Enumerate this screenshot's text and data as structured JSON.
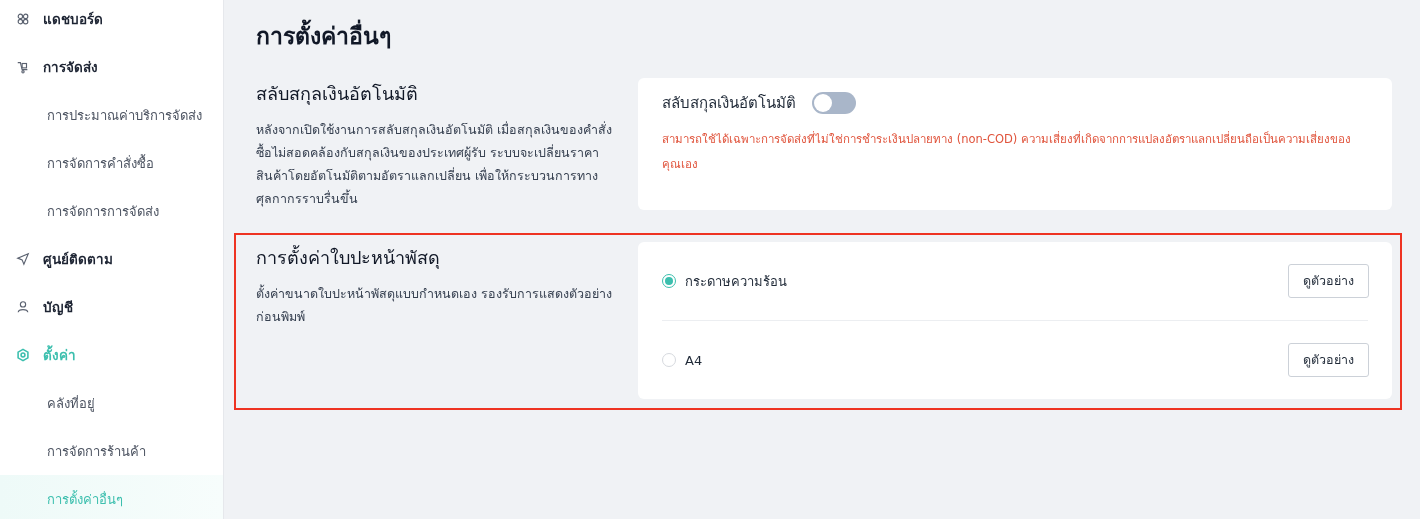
{
  "sidebar": {
    "items": [
      {
        "label": "แดชบอร์ด",
        "selected": false
      },
      {
        "label": "การจัดส่ง",
        "selected": false,
        "children": [
          {
            "label": "การประมาณค่าบริการจัดส่ง",
            "selected": false
          },
          {
            "label": "การจัดการคำสั่งซื้อ",
            "selected": false
          },
          {
            "label": "การจัดการการจัดส่ง",
            "selected": false
          }
        ]
      },
      {
        "label": "ศูนย์ติดตาม",
        "selected": false
      },
      {
        "label": "บัญชี",
        "selected": false
      },
      {
        "label": "ตั้งค่า",
        "selected": true,
        "children": [
          {
            "label": "คลังที่อยู่",
            "selected": false
          },
          {
            "label": "การจัดการร้านค้า",
            "selected": false
          },
          {
            "label": "การตั้งค่าอื่นๆ",
            "selected": true
          }
        ]
      }
    ]
  },
  "page_title": "การตั้งค่าอื่นๆ",
  "sections": [
    {
      "kind": "toggle",
      "title": "สลับสกุลเงินอัตโนมัติ",
      "description": "หลังจากเปิดใช้งานการสลับสกุลเงินอัตโนมัติ เมื่อสกุลเงินของคำสั่งซื้อไม่สอดคล้องกับสกุลเงินของประเทศผู้รับ ระบบจะเปลี่ยนราคาสินค้าโดยอัตโนมัติตามอัตราแลกเปลี่ยน เพื่อให้กระบวนการทางศุลกากรราบรื่นขึ้น",
      "highlighted": false,
      "toggle": {
        "label": "สลับสกุลเงินอัตโนมัติ",
        "on": false,
        "warning": "สามารถใช้ได้เฉพาะการจัดส่งที่ไม่ใช่การชำระเงินปลายทาง (non-COD) ความเสี่ยงที่เกิดจากการแปลงอัตราแลกเปลี่ยนถือเป็นความเสี่ยงของคุณเอง"
      }
    },
    {
      "kind": "radio",
      "title": "การตั้งค่าใบปะหน้าพัสดุ",
      "description": "ตั้งค่าขนาดใบปะหน้าพัสดุแบบกำหนดเอง รองรับการแสดงตัวอย่างก่อนพิมพ์",
      "highlighted": true,
      "options": [
        {
          "label": "กระดาษความร้อน",
          "selected": true,
          "button": "ดูตัวอย่าง"
        },
        {
          "label": "A4",
          "selected": false,
          "button": "ดูตัวอย่าง"
        }
      ]
    }
  ]
}
